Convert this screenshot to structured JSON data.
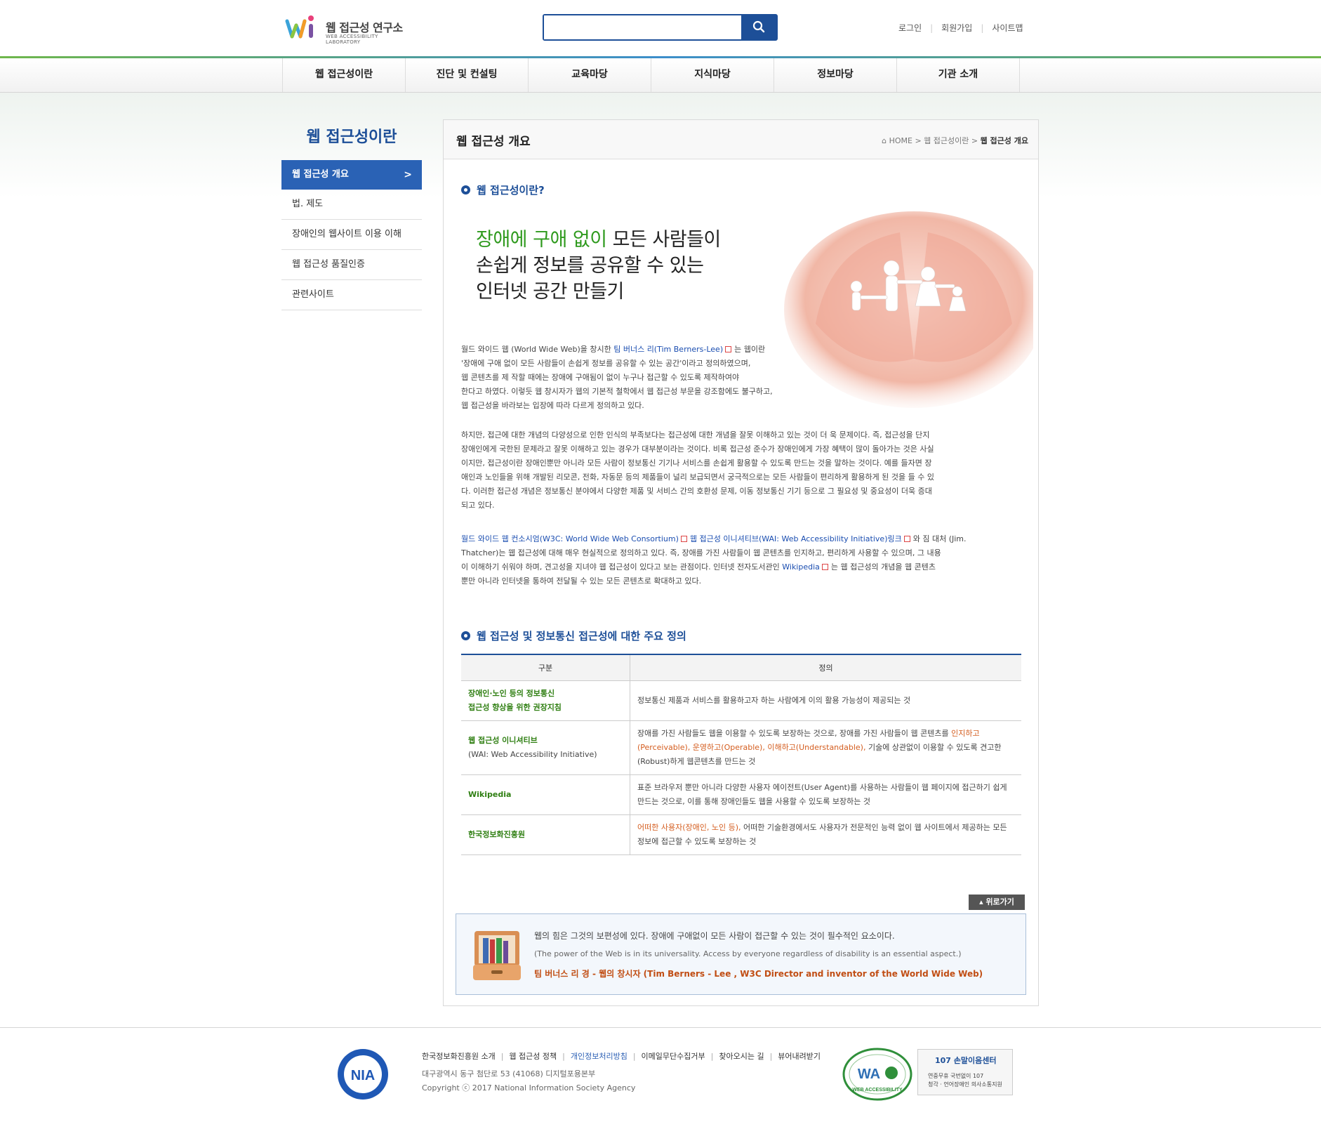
{
  "header": {
    "logo_name": "웹 접근성 연구소",
    "logo_sub": "WEB ACCESSIBILITY LABORATORY",
    "search_placeholder": "",
    "util_links": [
      "로그인",
      "회원가입",
      "사이트맵"
    ]
  },
  "gnb": [
    "웹 접근성이란",
    "진단 및 컨설팅",
    "교육마당",
    "지식마당",
    "정보마당",
    "기관 소개"
  ],
  "lnb": {
    "title": "웹 접근성이란",
    "items": [
      "웹 접근성 개요",
      "법. 제도",
      "장애인의 웹사이트 이용 이해",
      "웹 접근성 품질인증",
      "관련사이트"
    ],
    "active_arrow": ">"
  },
  "content": {
    "title": "웹 접근성 개요",
    "breadcrumb": {
      "home": "HOME",
      "sep": ">",
      "level1": "웹 접근성이란",
      "current": "웹 접근성 개요"
    },
    "section1_heading": "웹 접근성이란?",
    "slogan": {
      "green": "장애에 구애 없이",
      "line1_rest": " 모든 사람들이",
      "line2": "손쉽게 정보를 공유할 수 있는",
      "line3": "인터넷 공간 만들기"
    },
    "para1": {
      "a": "월드 와이드 웹 (World Wide Web)을 창시한 ",
      "link": "팀 버너스 리(Tim Berners-Lee)",
      "b": "는 웹이란",
      "l2": "'장애에 구애 없이 모든 사람들이 손쉽게 정보를 공유할 수 있는 공간'이라고 정의하였으며,",
      "l3": "웹 콘텐츠를 제 작할 때에는 장애에 구애됨이 없이 누구나 접근할 수 있도록 제작하여야",
      "l4": "한다고 하였다. 이렇듯 웹 창시자가 웹의 기본적 철학에서 웹 접근성 부문을 강조함에도 불구하고,",
      "l5": "웹 접근성을 바라보는 입장에 따라 다르게 정의하고 있다."
    },
    "para2": [
      "하지만, 접근에 대한 개념의 다양성으로 인한 인식의 부족보다는 접근성에 대한 개념을 잘못 이해하고 있는 것이 더 욱 문제이다. 즉, 접근성을 단지",
      "장애인에게 국한된 문제라고 잘못 이해하고 있는 경우가 대부분이라는 것이다. 비록 접근성 준수가 장애인에게 가장 혜택이 많이 돌아가는 것은 사실",
      "이지만, 접근성이란 장애인뿐만 아니라 모든 사람이 정보통신 기기나 서비스를 손쉽게 활용할 수 있도록 만드는 것을 말하는 것이다. 예를 들자면 장",
      "애인과 노인들을 위해 개발된 리모콘, 전화, 자동문 등의 제품들이 널리 보급되면서 궁극적으로는 모든 사람들이 편리하게 활용하게 된 것을 들 수 있",
      "다. 이러한 접근성 개념은 정보통신 분야에서 다양한 제품 및 서비스 간의 호환성 문제, 이동 정보통신 기기 등으로 그 필요성 및 중요성이 더욱 증대",
      "되고 있다."
    ],
    "para3": {
      "link1": "월드 와이드 웹 컨소시엄(W3C: World Wide Web Consortium)",
      "link2": "웹 접근성 이니셔티브(WAI: Web Accessibility Initiative)링크",
      "a": "와 짐 대처 (Jim.",
      "l2": "Thatcher)는 웹 접근성에 대해 매우 현실적으로 정의하고 있다. 즉, 장애를 가진 사람들이 웹 콘텐츠를 인지하고, 편리하게 사용할 수 있으며, 그 내용",
      "l3a": "이 이해하기 쉬워야 하며, 견고성을 지녀야 웹 접근성이 있다고 보는 관점이다. 인터넷 전자도서관인 ",
      "link3": "Wikipedia",
      "l3b": "는 웹 접근성의 개념을 웹 콘텐츠",
      "l4": "뿐만 아니라 인터넷을 통하여 전달될 수 있는 모든 콘텐츠로 확대하고 있다."
    },
    "section2_heading": "웹 접근성 및 정보통신 접근성에 대한 주요 정의",
    "table": {
      "headers": [
        "구분",
        "정의"
      ],
      "rows": [
        {
          "title": "장애인·노인 등의 정보통신",
          "title2": "접근성 향상을 위한 권장지침",
          "title_en": "",
          "def_a": "정보통신 제품과 서비스를 활용하고자 하는 사람에게 이의 활용 가능성이 제공되는 것",
          "def_orange": "",
          "def_b": ""
        },
        {
          "title": "웹 접근성 이니셔티브",
          "title2": "",
          "title_en": "(WAI: Web Accessibility Initiative)",
          "def_a": "장애를 가진 사람들도 웹을 이용할 수 있도록 보장하는 것으로, 장애를 가진 사람들이 웹 콘텐츠를 ",
          "def_orange": "인지하고(Perceivable), 운영하고(Operable), 이해하고(Understandable),",
          "def_b": " 기술에 상관없이 이용할 수 있도록 견고한(Robust)하게 웹콘텐츠를 만드는 것"
        },
        {
          "title": "Wikipedia",
          "title2": "",
          "title_en": "",
          "def_a": "표준 브라우저 뿐만 아니라 다양한 사용자 에이전트(User Agent)를 사용하는 사람들이 웹 페이지에 접근하기 쉽게 만드는 것으로, 이를 통해 장애인들도 웹을 사용할 수 있도록 보장하는 것",
          "def_orange": "",
          "def_b": ""
        },
        {
          "title": "한국정보화진흥원",
          "title2": "",
          "title_en": "",
          "def_a": "",
          "def_orange": "어떠한 사용자(장애인, 노인 등),",
          "def_b": " 어떠한 기술환경에서도 사용자가 전문적인 능력 없이 웹 사이트에서 제공하는 모든 정보에 접근할 수 있도록 보장하는 것"
        }
      ]
    },
    "top_button": "위로가기",
    "quote": {
      "korean": "웹의 힘은 그것의 보편성에 있다. 장애에 구애없이 모든 사람이 접근할 수 있는 것이 필수적인 요소이다.",
      "english": "(The power of the Web is in its universality. Access by everyone regardless of disability is an essential aspect.)",
      "attribution": "팀 버너스 리 경 - 웹의 창시자 (Tim Berners - Lee , W3C Director and inventor of the World Wide Web)"
    }
  },
  "footer": {
    "nia_logo": "NIA",
    "links": [
      "한국정보화진흥원 소개",
      "웹 접근성 정책",
      "개인정보처리방침",
      "이메일무단수집거부",
      "찾아오시는 길",
      "뷰어내려받기"
    ],
    "address": "대구광역시 동구 첨단로 53 (41068) 디지털포용본부",
    "copyright": "Copyright ⓒ 2017 National Information Society Agency",
    "wa_badge": "WEB ACCESSIBILITY",
    "center_title": "107 손말이음센터",
    "center_line1": "연중무휴 국번없이 107",
    "center_line2": "청각 · 언어장애인 의사소통지원"
  },
  "colors": {
    "brand_blue": "#1d4f98",
    "green": "#2f9a1e",
    "orange": "#d45d1f"
  }
}
